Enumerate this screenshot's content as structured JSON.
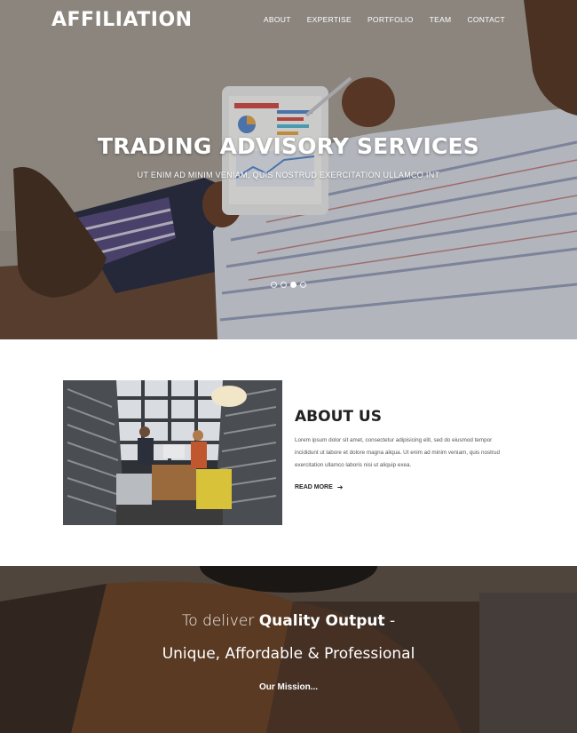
{
  "header": {
    "logo": "AFFILIATION",
    "nav": [
      "ABOUT",
      "EXPERTISE",
      "PORTFOLIO",
      "TEAM",
      "CONTACT"
    ]
  },
  "hero": {
    "title": "TRADING ADVISORY SERVICES",
    "subtitle": "UT ENIM AD MINIM VENIAM, QUIS NOSTRUD EXERCITATION ULLAMCO INT",
    "slides_total": 4,
    "active_slide": 3
  },
  "about": {
    "title": "ABOUT US",
    "text": "Lorem ipsum dolor sit amet, consectetur adipisicing elit, sed do eiusmod tempor incididunt ut labore et dolore magna aliqua. Ut enim ad minim veniam, quis nostrud exercitation ullamco laboris nisi ut aliquip exea.",
    "read_more": "READ MORE",
    "read_more_icon": "arrow-right-icon"
  },
  "mission": {
    "line1_prefix": "To deliver",
    "line1_strong": "Quality Output",
    "line1_suffix": "-",
    "line2": "Unique, Affordable & Professional",
    "link": "Our Mission..."
  },
  "colors": {
    "text_dark": "#222222",
    "text_body": "#555555",
    "white": "#ffffff"
  }
}
